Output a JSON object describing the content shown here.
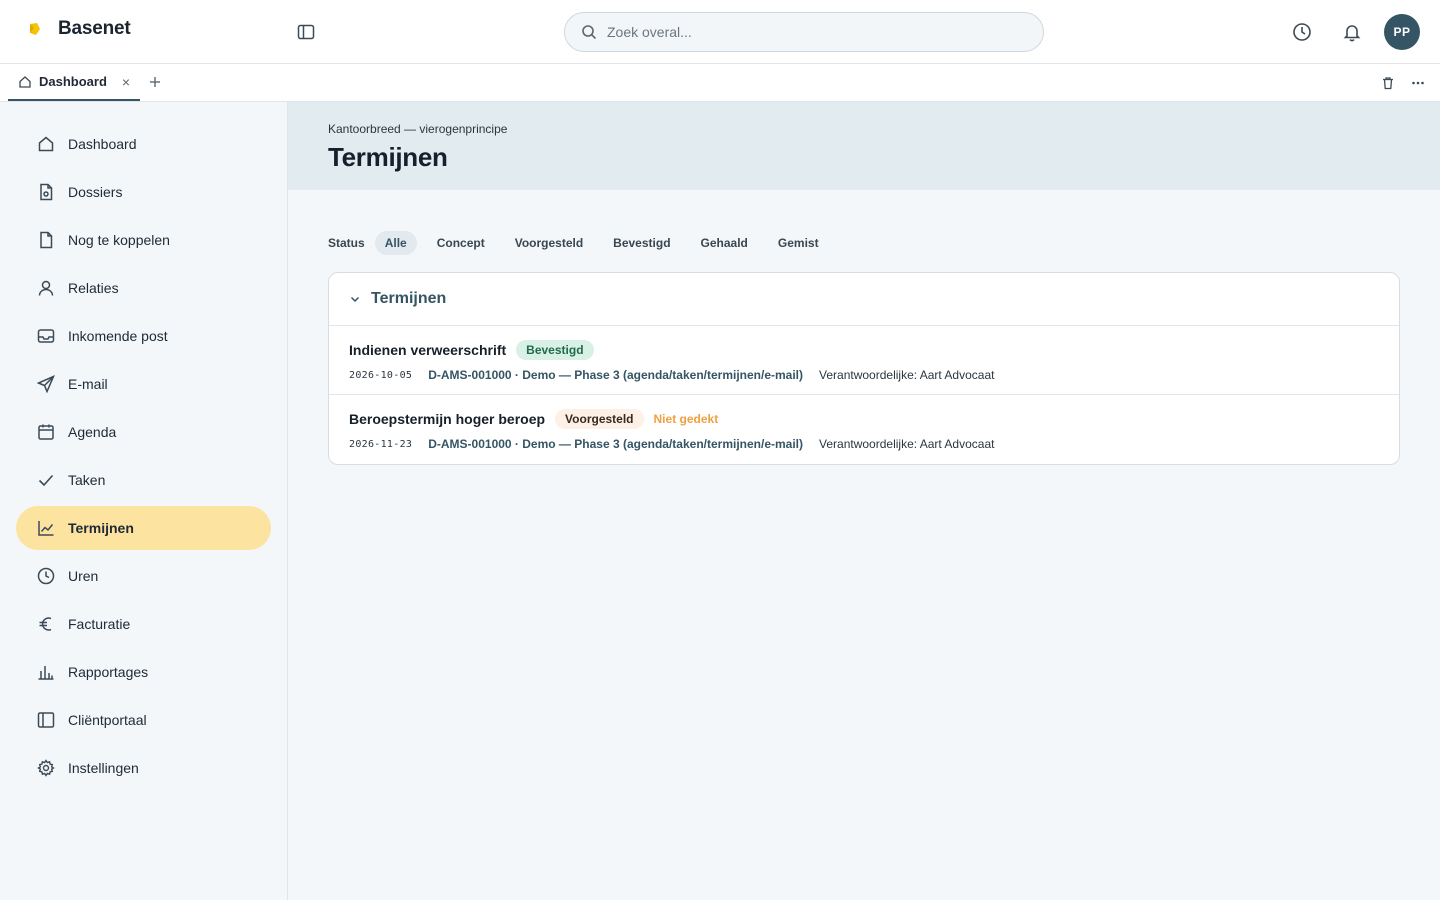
{
  "brand": {
    "name": "Basenet",
    "logo_color": "#f5c400"
  },
  "search": {
    "placeholder": "Zoek overal..."
  },
  "user": {
    "initials": "PP",
    "avatar_color": "#355565"
  },
  "tabs": [
    {
      "label": "Dashboard",
      "close": "×"
    }
  ],
  "sidebar": {
    "items": [
      {
        "label": "Dashboard",
        "icon": "home-icon"
      },
      {
        "label": "Dossiers",
        "icon": "file-icon"
      },
      {
        "label": "Nog te koppelen",
        "icon": "document-icon"
      },
      {
        "label": "Relaties",
        "icon": "user-icon"
      },
      {
        "label": "Inkomende post",
        "icon": "inbox-icon"
      },
      {
        "label": "E-mail",
        "icon": "send-icon"
      },
      {
        "label": "Agenda",
        "icon": "calendar-icon"
      },
      {
        "label": "Taken",
        "icon": "check-icon"
      },
      {
        "label": "Termijnen",
        "icon": "chart-line-icon",
        "active": true
      },
      {
        "label": "Uren",
        "icon": "clock-icon"
      },
      {
        "label": "Facturatie",
        "icon": "euro-icon"
      },
      {
        "label": "Rapportages",
        "icon": "bar-chart-icon"
      },
      {
        "label": "Cliëntportaal",
        "icon": "panel-icon"
      },
      {
        "label": "Instellingen",
        "icon": "gear-icon"
      }
    ],
    "active_color": "#fde3a0"
  },
  "header": {
    "breadcrumb": "Kantoorbreed — vierogenprincipe",
    "title": "Termijnen"
  },
  "filters": {
    "label": "Status",
    "options": [
      "Alle",
      "Concept",
      "Voorgesteld",
      "Bevestigd",
      "Gehaald",
      "Gemist"
    ],
    "selected": "Alle"
  },
  "card": {
    "title": "Termijnen",
    "rows": [
      {
        "title": "Indienen verweerschrift",
        "status": "Bevestigd",
        "warning": "",
        "date": "2026-10-05",
        "dossier": "D-AMS-001000 · Demo — Phase 3 (agenda/taken/termijnen/e-mail)",
        "owner": "Verantwoordelijke: Aart Advocaat"
      },
      {
        "title": "Beroepstermijn hoger beroep",
        "status": "Voorgesteld",
        "warning": "Niet gedekt",
        "date": "2026-11-23",
        "dossier": "D-AMS-001000 · Demo — Phase 3 (agenda/taken/termijnen/e-mail)",
        "owner": "Verantwoordelijke: Aart Advocaat"
      }
    ]
  }
}
